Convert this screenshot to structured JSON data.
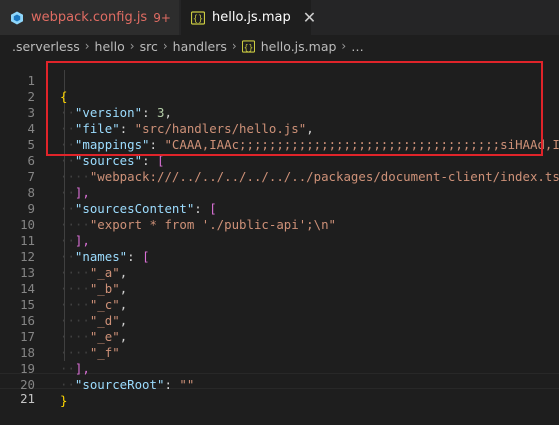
{
  "tabs": [
    {
      "label": "webpack.config.js",
      "badge": "9+",
      "icon": "webpack-icon"
    },
    {
      "label": "hello.js.map",
      "icon": "json-braces-icon",
      "close": "✕"
    }
  ],
  "breadcrumbs": [
    ".serverless",
    "hello",
    "src",
    "handlers",
    "hello.js.map",
    "…"
  ],
  "line_numbers": [
    "1",
    "2",
    "3",
    "4",
    "5",
    "6",
    "7",
    "8",
    "9",
    "10",
    "11",
    "12",
    "13",
    "14",
    "15",
    "16",
    "17",
    "18",
    "19",
    "20",
    "21"
  ],
  "code": {
    "l1_open": "{",
    "l2_key": "\"version\"",
    "l2_val": "3",
    "l3_key": "\"file\"",
    "l3_val": "\"src/handlers/hello.js\"",
    "l4_key": "\"mappings\"",
    "l4_val": "\"CAAA,IAAc;;;;;;;;;;;;;;;;;;;;;;;;;;;;;;;;;;;siHAAd,IAA",
    "l5_key": "\"sources\"",
    "l5_open": "[",
    "l6_val": "\"webpack:///../../../../../../packages/document-client/index.ts\"",
    "l7_close": "],",
    "l8_key": "\"sourcesContent\"",
    "l8_open": "[",
    "l9_val": "\"export * from './public-api';\\n\"",
    "l10_close": "],",
    "l11_key": "\"names\"",
    "l11_open": "[",
    "l12_val": "\"_a\"",
    "l13_val": "\"_b\"",
    "l14_val": "\"_c\"",
    "l15_val": "\"_d\"",
    "l16_val": "\"_e\"",
    "l17_val": "\"_f\"",
    "l18_close": "],",
    "l19_key": "\"sourceRoot\"",
    "l19_val": "\"\"",
    "l20_close": "}"
  },
  "colors": {
    "tab_error": "#e06c63",
    "highlight_border": "#e0242a",
    "json_key": "#9cdcfe",
    "json_string": "#ce9178",
    "json_number": "#b5cea8"
  }
}
